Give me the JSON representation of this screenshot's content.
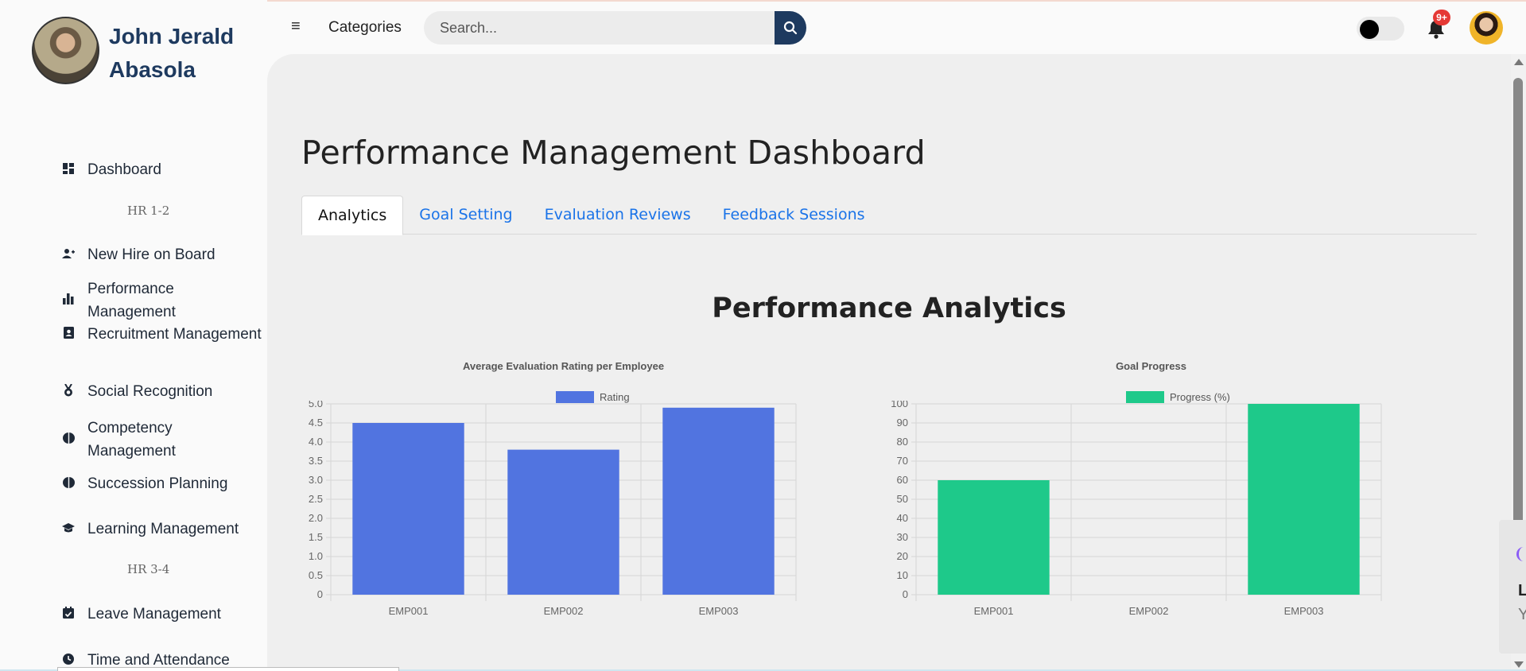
{
  "user": {
    "name_line1": "John Jerald",
    "name_line2": "Abasola"
  },
  "header": {
    "categories_label": "Categories",
    "search_placeholder": "Search...",
    "notification_count": "9+"
  },
  "sidebar": {
    "items": [
      {
        "label": "Dashboard",
        "icon": "dashboard-icon"
      },
      {
        "section": "HR 1-2"
      },
      {
        "label": "New Hire on Board",
        "icon": "user-plus-icon"
      },
      {
        "label": "Performance Management",
        "icon": "bar-chart-icon"
      },
      {
        "label": "Recruitment Management",
        "icon": "id-badge-icon"
      },
      {
        "label": "Social Recognition",
        "icon": "medal-icon"
      },
      {
        "label": "Competency Management",
        "icon": "brain-icon"
      },
      {
        "label": "Succession Planning",
        "icon": "brain-icon"
      },
      {
        "label": "Learning Management",
        "icon": "graduation-cap-icon"
      },
      {
        "section": "HR 3-4"
      },
      {
        "label": "Leave Management",
        "icon": "calendar-check-icon"
      },
      {
        "label": "Time and Attendance",
        "icon": "clock-icon"
      }
    ]
  },
  "main": {
    "page_title": "Performance Management Dashboard",
    "tabs": [
      {
        "label": "Analytics",
        "active": true
      },
      {
        "label": "Goal Setting",
        "active": false
      },
      {
        "label": "Evaluation Reviews",
        "active": false
      },
      {
        "label": "Feedback Sessions",
        "active": false
      }
    ],
    "section_title": "Performance Analytics"
  },
  "side_widget": {
    "line1": "L",
    "line2": "Y"
  },
  "chart_data": [
    {
      "type": "bar",
      "title": "Average Evaluation Rating per Employee",
      "categories": [
        "EMP001",
        "EMP002",
        "EMP003"
      ],
      "series": [
        {
          "name": "Rating",
          "values": [
            4.5,
            3.8,
            4.9
          ],
          "color": "#5174e0"
        }
      ],
      "ylim": [
        0,
        5
      ],
      "yticks": [
        "0",
        "0.5",
        "1.0",
        "1.5",
        "2.0",
        "2.5",
        "3.0",
        "3.5",
        "4.0",
        "4.5",
        "5.0"
      ],
      "grid": true,
      "legend": "top"
    },
    {
      "type": "bar",
      "title": "Goal Progress",
      "categories": [
        "EMP001",
        "EMP002",
        "EMP003"
      ],
      "series": [
        {
          "name": "Progress (%)",
          "values": [
            60,
            0,
            100
          ],
          "color": "#1ec98a"
        }
      ],
      "ylim": [
        0,
        100
      ],
      "yticks": [
        "0",
        "10",
        "20",
        "30",
        "40",
        "50",
        "60",
        "70",
        "80",
        "90",
        "100"
      ],
      "grid": true,
      "legend": "top"
    }
  ]
}
